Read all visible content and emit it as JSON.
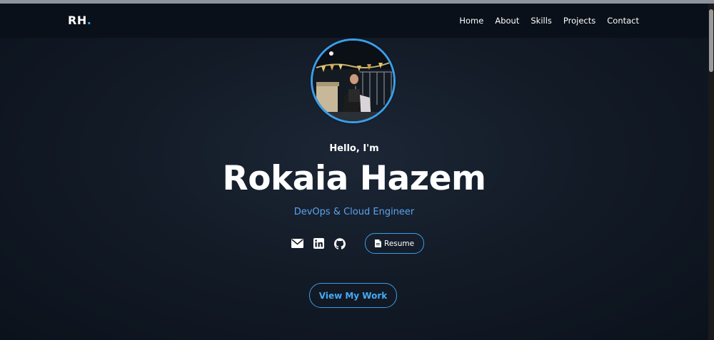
{
  "nav": {
    "logo": "RH",
    "logo_dot": ".",
    "links": [
      "Home",
      "About",
      "Skills",
      "Projects",
      "Contact"
    ]
  },
  "hero": {
    "greeting": "Hello, I'm",
    "name": "Rokaia Hazem",
    "role": "DevOps & Cloud Engineer",
    "social_icons": [
      "envelope-icon",
      "linkedin-icon",
      "github-icon"
    ],
    "resume_label": "Resume",
    "cta_label": "View My Work"
  },
  "colors": {
    "accent": "#3a9ee8",
    "role_text": "#5aa4ee",
    "background": "#131b27",
    "navbar": "#0a1019"
  }
}
